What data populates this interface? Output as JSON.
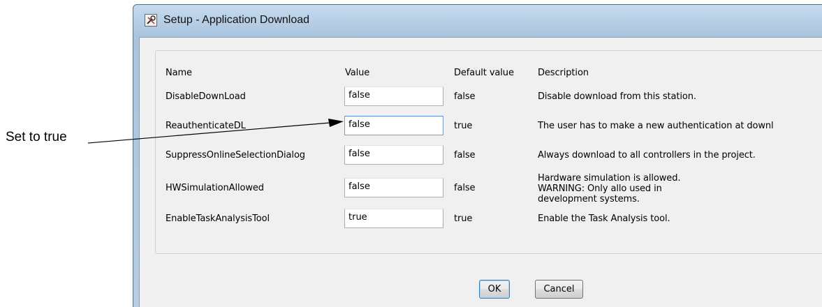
{
  "annotation": {
    "text": "Set to true"
  },
  "window": {
    "title": "Setup - Application Download"
  },
  "table": {
    "headers": {
      "name": "Name",
      "value": "Value",
      "default": "Default value",
      "description": "Description"
    },
    "rows": [
      {
        "name": "DisableDownLoad",
        "value": "false",
        "default": "false",
        "description": "Disable download from this station."
      },
      {
        "name": "ReauthenticateDL",
        "value": "false",
        "default": "true",
        "description": "The user has to make a new authentication at downl"
      },
      {
        "name": "SuppressOnlineSelectionDialog",
        "value": "false",
        "default": "false",
        "description": "Always download to all controllers in the project."
      },
      {
        "name": "HWSimulationAllowed",
        "value": "false",
        "default": "false",
        "description": "Hardware simulation is allowed. WARNING: Only allo used in development systems."
      },
      {
        "name": "EnableTaskAnalysisTool",
        "value": "true",
        "default": "true",
        "description": "Enable the Task Analysis tool."
      }
    ]
  },
  "buttons": {
    "ok": "OK",
    "cancel": "Cancel"
  }
}
